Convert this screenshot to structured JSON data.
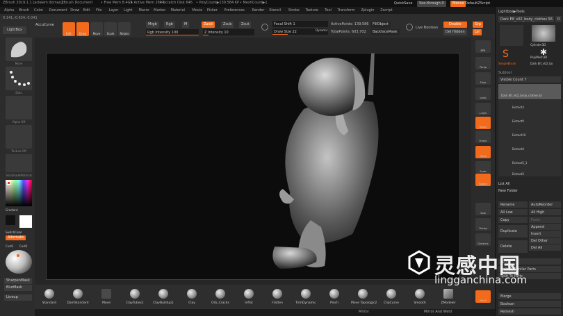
{
  "title": {
    "app": "ZBrush 2019.1.1 [ackeem dornan]",
    "document": "ZBrush Document",
    "free_mem": "• Free Mem 8.4GB",
    "active_mem": "• Active Mem 2804",
    "scratch": "• Scratch Disk 646",
    "polycount": "• PolyCount▶139.584 KP",
    "meshcount": "• MeshCount▶1"
  },
  "topright": {
    "quicksave": "QuickSave",
    "seethrough": "See-through  0",
    "menus": "Menus",
    "defaultscript": "DefaultZScript"
  },
  "menu": [
    "Alpha",
    "Brush",
    "Color",
    "Document",
    "Draw",
    "Edit",
    "File",
    "Layer",
    "Light",
    "Macro",
    "Marker",
    "Material",
    "Movie",
    "Picker",
    "Preferences",
    "Render",
    "Stencil",
    "Stroke",
    "Texture",
    "Tool",
    "Transform",
    "Zplugin",
    "Zscript"
  ],
  "coords": "0.141,-0.634,-0.041",
  "toolbar": {
    "lightbox": "LightBox",
    "accucurve": "AccuCurve",
    "edit": "Edit",
    "draw": "Draw",
    "move": "Move",
    "scale": "Scale",
    "rotate": "Rotate",
    "mrgb": "Mrgb",
    "rgb": "Rgb",
    "m": "M",
    "zadd": "Zadd",
    "zsub": "Zsub",
    "zcut": "Zcut",
    "rgb_intensity": "Rgb Intensity 100",
    "z_intensity": "Z Intensity 10",
    "focal_shift": "Focal Shift 1",
    "draw_size": "Draw Size 22",
    "dynamic": "Dynamic",
    "active_points": "ActivePoints: 139,586",
    "total_points": "TotalPoints: 603,702",
    "fill_object": "FillObject",
    "backface_mask": "BackfaceMask",
    "line_boolean": "Live Boolean",
    "double": "Double",
    "del_hidden": "Del Hidden",
    "grp": "Grp",
    "lyr": "Lyr"
  },
  "leftshelf": {
    "brush_label": "Move",
    "stroke_label": "Dots",
    "alpha_label": "Alpha Off",
    "texture_label": "Texture Off",
    "material_label": "SkinShadeMaterial",
    "gradient": "Gradient",
    "switchcolor": "SwitchColor",
    "alternate": "Alternate",
    "cust1": "Cust1",
    "cust2": "Cust2",
    "sharpen_mask": "SharpenMask",
    "blur_mask": "BlurMask",
    "lineup": "Lineup"
  },
  "rightshelf": [
    "BPR",
    "Persp",
    "Floor",
    "Local",
    "L.Sym",
    "Xpose",
    "Frame",
    "Move",
    "Scale",
    "Rotate",
    "Solo",
    "Transp",
    "Dynamic",
    "PolyF"
  ],
  "rightpanel": {
    "lightbox_tools": "Lightbox▶Tools",
    "current_tool": "Dark Elf_v02_body_clothes 56",
    "r_label": "R",
    "thumbs": [
      "Cylinder3D",
      "PolyMesh3D",
      "SimpleBrush",
      "Dark Elf_v02_bo"
    ],
    "subtool": "Subtool",
    "visible_count": "Visible Count 7",
    "subtools": [
      "Dark Elf_v02_body_clothes bl",
      "Extract3",
      "Extract9",
      "Extract10",
      "Extract4",
      "Extract5_1",
      "Extract5"
    ],
    "list_all": "List All",
    "new_folder": "New Folder",
    "rename": "Rename",
    "auto_reorder": "AutoReorder",
    "all_low": "All Low",
    "all_high": "All High",
    "copy": "Copy",
    "paste": "Paste",
    "duplicate": "Duplicate",
    "append": "Append",
    "insert": "Insert",
    "delete": "Delete",
    "del_other": "Del Other",
    "del_all": "Del All",
    "split": "Split",
    "merge": "Merge",
    "boolean": "Boolean",
    "remesh": "Remesh",
    "split_unmasked": "Split To Similar Parts",
    "split_to_parts": "Split To Parts",
    "mirror": "Mirror",
    "mirror_weld": "Mirror And Weld"
  },
  "brushes": [
    "Standard",
    "DamStandard",
    "Move",
    "ClayTubes1",
    "ClayBuildup1",
    "Clay",
    "Orb_Cracks",
    "Inflat",
    "Flatten",
    "TrimDynamic",
    "Pinch",
    "Move Topologic2",
    "ClipCurve",
    "Smooth",
    "ZModeler"
  ],
  "watermark": {
    "cn": "灵感中国",
    "url": "lingganchina.com"
  },
  "colors": {
    "accent": "#f26a1b",
    "panel": "#2d2d2d",
    "viewport": "#0c0c0c"
  }
}
